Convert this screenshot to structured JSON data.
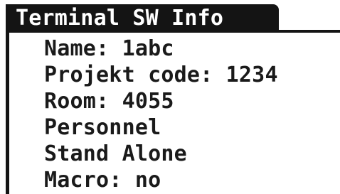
{
  "panel": {
    "title": "Terminal SW Info",
    "lines": [
      "Name: 1abc",
      "Projekt code: 1234",
      "Room: 4055",
      "Personnel",
      "Stand Alone",
      "Macro: no"
    ]
  }
}
